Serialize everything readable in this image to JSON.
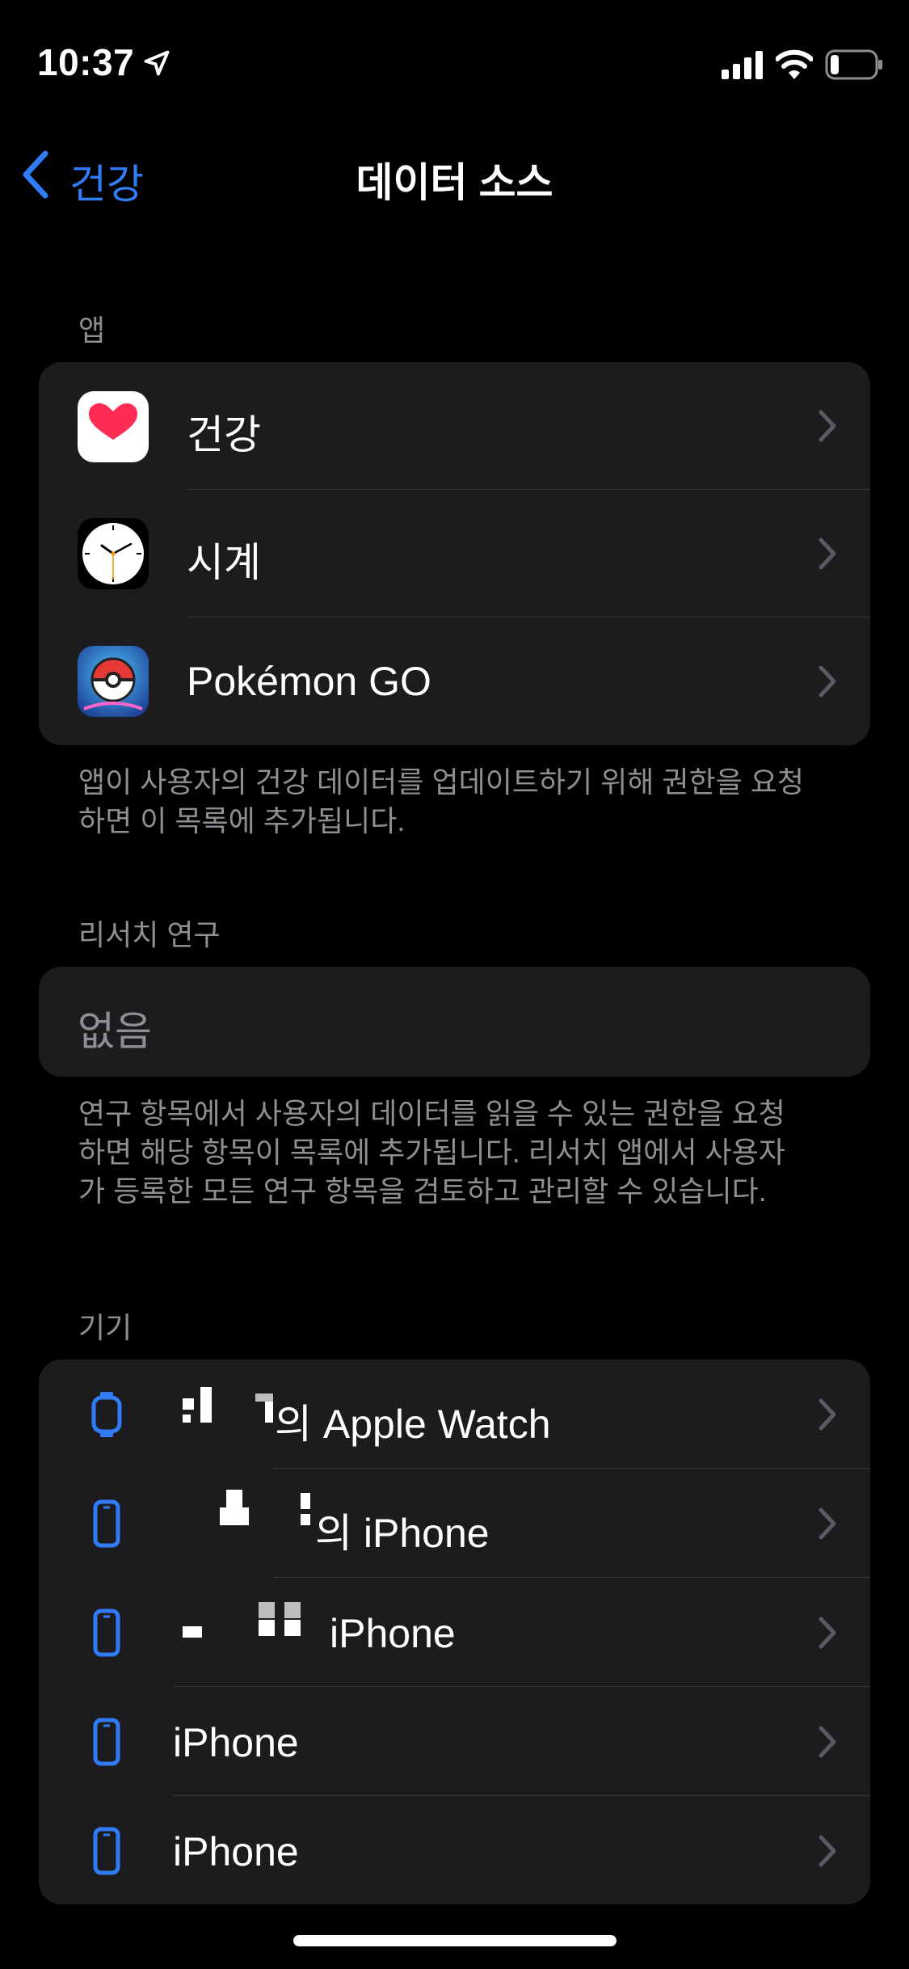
{
  "status_bar": {
    "time": "10:37"
  },
  "nav": {
    "back_label": "건강",
    "title": "데이터 소스"
  },
  "apps_section": {
    "header": "앱",
    "items": [
      {
        "label": "건강",
        "icon": "health-app-icon"
      },
      {
        "label": "시계",
        "icon": "clock-app-icon"
      },
      {
        "label": "Pokémon GO",
        "icon": "pokemon-go-app-icon"
      }
    ],
    "footer": "앱이 사용자의 건강 데이터를 업데이트하기 위해 권한을 요청하면 이 목록에 추가됩니다."
  },
  "research_section": {
    "header": "리서치 연구",
    "empty_label": "없음",
    "footer": "연구 항목에서 사용자의 데이터를 읽을 수 있는 권한을 요청하면 해당 항목이 목록에 추가됩니다. 리서치 앱에서 사용자가 등록한 모든 연구 항목을 검토하고 관리할 수 있습니다."
  },
  "devices_section": {
    "header": "기기",
    "items": [
      {
        "label": "의 Apple Watch",
        "icon": "apple-watch-icon"
      },
      {
        "label": "의 iPhone",
        "icon": "iphone-icon"
      },
      {
        "label": "iPhone",
        "icon": "iphone-icon"
      },
      {
        "label": "iPhone",
        "icon": "iphone-icon"
      },
      {
        "label": "iPhone",
        "icon": "iphone-icon"
      }
    ]
  },
  "colors": {
    "background": "#000000",
    "cell_background": "#1c1c1e",
    "accent_blue": "#2f7cf6",
    "secondary_text": "#8e8e93",
    "separator": "#38383a",
    "chevron": "#5a5a5f"
  }
}
